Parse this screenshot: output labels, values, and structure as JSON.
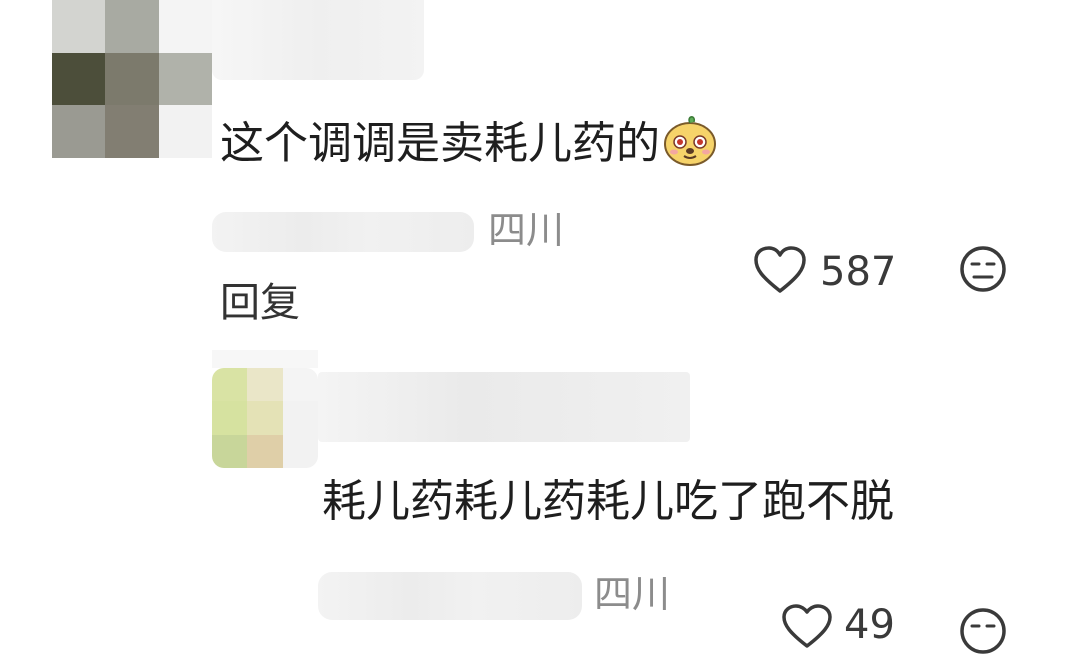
{
  "comments": [
    {
      "text": "这个调调是卖耗儿药的",
      "location": "四川",
      "reply_label": "回复",
      "likes": "587",
      "sticker_icon": "cute-dog-sticker-icon"
    },
    {
      "text": "耗儿药耗儿药耗儿吃了跑不脱",
      "location": "四川",
      "likes": "49"
    }
  ],
  "icons": {
    "like": "heart-outline-icon",
    "dislike": "meh-face-icon"
  },
  "colors": {
    "text": "#1e1e1e",
    "meta": "#8c8c8c",
    "background": "#ffffff"
  }
}
